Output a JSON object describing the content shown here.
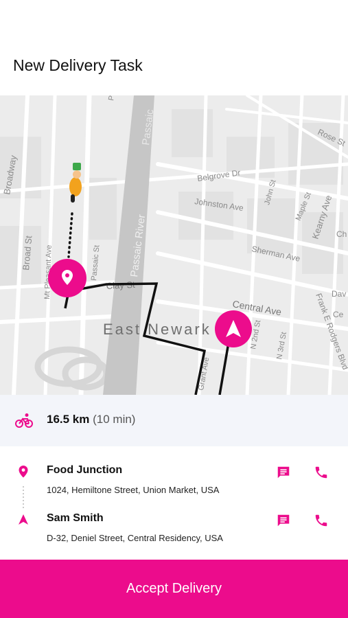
{
  "header": {
    "title": "New Delivery Task"
  },
  "map": {
    "labels": {
      "broadway": "Broadway",
      "broad_st": "Broad St",
      "mt_pleasant": "Mt Pleasant Ave",
      "passaic_st": "Passaic St",
      "passaic_river": "Passaic River",
      "passaic_top": "Passaic",
      "belgrove": "Belgrove Dr",
      "johnston": "Johnston Ave",
      "john_st": "John St",
      "maple_st": "Maple St",
      "kearny": "Kearny Ave",
      "rose": "Rose St",
      "sherman": "Sherman Ave",
      "central": "Central Ave",
      "clay": "Clay St",
      "east_newark": "East Newark",
      "second_st": "N 2nd St",
      "third_st": "N 3rd St",
      "frank": "Frank E Rodgers Blvd",
      "dav": "Dav",
      "ce": "Ce",
      "ch": "Ch",
      "grant": "Grant Ave"
    },
    "accent": "#ec0c8c",
    "icons": {
      "rider": "delivery-rider-icon",
      "pickup": "location-pin-icon",
      "dropoff": "navigation-arrow-icon"
    }
  },
  "summary": {
    "distance": "16.5 km",
    "duration": "(10 min)",
    "icon": "bicycle-icon"
  },
  "stops": [
    {
      "name": "Food Junction",
      "address": "1024, Hemiltone Street, Union Market, USA",
      "icon": "location-pin-icon"
    },
    {
      "name": "Sam Smith",
      "address": "D-32,  Deniel Street, Central Residency, USA",
      "icon": "navigation-arrow-icon"
    }
  ],
  "actions": {
    "chat_icon": "chat-icon",
    "call_icon": "phone-icon"
  },
  "footer": {
    "accept_label": "Accept Delivery"
  }
}
